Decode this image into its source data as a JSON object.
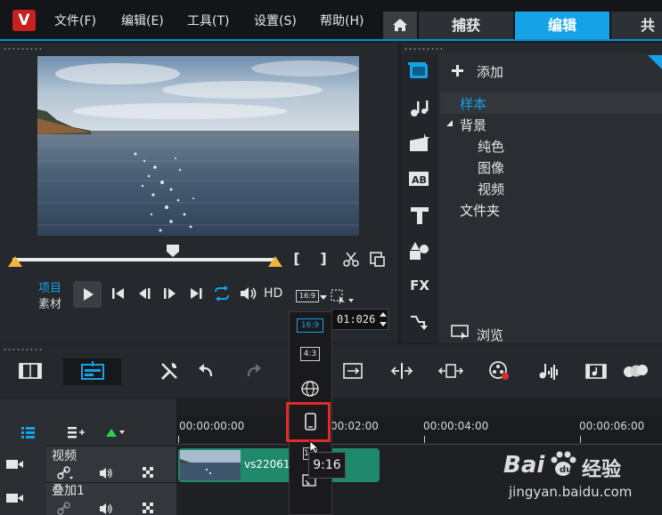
{
  "menubar": {
    "logo": "V",
    "items": [
      "文件(F)",
      "编辑(E)",
      "工具(T)",
      "设置(S)",
      "帮助(H)"
    ]
  },
  "workspace_tabs": {
    "home_icon": "home-icon",
    "capture": "捕获",
    "edit": "编辑",
    "share": "共享"
  },
  "player": {
    "mode_project": "项目",
    "mode_clip": "素材",
    "hd": "HD",
    "aspect": "16:9",
    "timecode": "01:026",
    "mark_in": "[",
    "mark_out": "]"
  },
  "library": {
    "add": "添加",
    "tree": {
      "sample": "样本",
      "background": "背景",
      "color": "纯色",
      "image": "图像",
      "video": "视频",
      "folder": "文件夹"
    },
    "browse": "浏览",
    "side_fx": "FX"
  },
  "timeline": {
    "ruler": [
      "00:00:00:00",
      "00:00:02:00",
      "00:00:04:00",
      "00:00:06:00"
    ],
    "ruler_partial": "00:02:00",
    "tracks": [
      {
        "name": "视频"
      },
      {
        "name": "叠加1"
      }
    ],
    "clip_label": "vs22061"
  },
  "ratio_menu": {
    "options": [
      "16:9",
      "4:3",
      "360",
      "9:16",
      "1:1"
    ],
    "tooltip": "9:16"
  },
  "watermark": {
    "brand": "Bai",
    "brand2": "经验",
    "url": "jingyan.baidu.com"
  },
  "colors": {
    "accent": "#15a2e6",
    "highlight": "#e12a2a",
    "clip": "#1f8a6b",
    "trim": "#f1b53b"
  }
}
